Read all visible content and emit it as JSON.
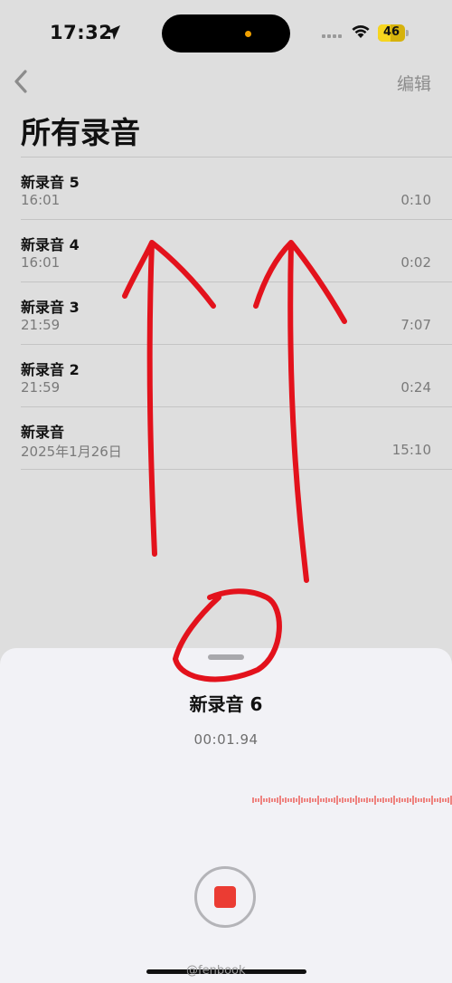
{
  "status_bar": {
    "time": "17:32",
    "battery": "46",
    "battery_level": 0.46
  },
  "nav": {
    "edit_label": "编辑"
  },
  "page_title": "所有录音",
  "recordings": [
    {
      "name": "新录音 5",
      "date": "16:01",
      "duration": "0:10"
    },
    {
      "name": "新录音 4",
      "date": "16:01",
      "duration": "0:02"
    },
    {
      "name": "新录音 3",
      "date": "21:59",
      "duration": "7:07"
    },
    {
      "name": "新录音 2",
      "date": "21:59",
      "duration": "0:24"
    },
    {
      "name": "新录音",
      "date": "2025年1月26日",
      "duration": "15:10"
    }
  ],
  "sheet": {
    "title": "新录音 6",
    "timer": "00:01.94"
  },
  "watermark": "@fenbook",
  "colors": {
    "accent_red": "#eb3c33",
    "annotation_red": "#e3121c",
    "background": "#dedede",
    "sheet": "#f2f2f6"
  },
  "icons": [
    "location-arrow-icon",
    "cellular-signal-icon",
    "wifi-icon",
    "battery-icon",
    "chevron-left-icon",
    "stop-icon"
  ]
}
